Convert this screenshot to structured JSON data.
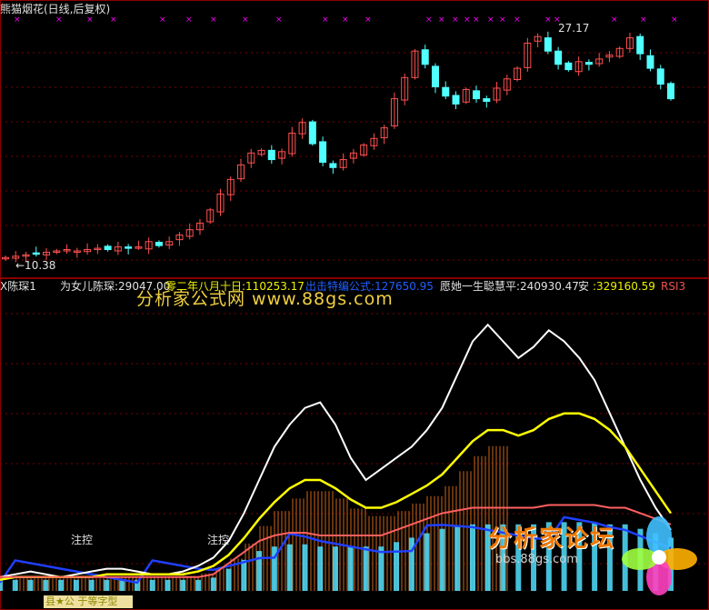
{
  "title": "熊猫烟花(日线,后复权)",
  "price_high_label": "27.17",
  "price_low_label": "←10.38",
  "indicator": {
    "name": "X陈琛1",
    "items": [
      {
        "label": "为女儿陈琛:29047.00",
        "color": "#e0e0e0"
      },
      {
        "label": "零二年八月十日:110253.17",
        "color": "#f0f000"
      },
      {
        "label": "出击",
        "color": "#2060ff"
      },
      {
        "label": "特编公式:127650.95",
        "color": "#2060ff"
      },
      {
        "label": "愿她一生聪慧平:240930.47",
        "color": "#e0e0e0"
      },
      {
        "label": "安",
        "color": "#e0e0e0"
      },
      {
        "label": ":329160.59",
        "color": "#f0f000"
      },
      {
        "label": "RSI3",
        "color": "#f05050"
      }
    ]
  },
  "annotations": [
    "注控",
    "注控"
  ],
  "watermarks": {
    "top": "分析家公式网 www.88gs.com",
    "logo": "分析家论坛",
    "url": "bbs.88gs.com"
  },
  "bottom_tab": "县★公 于等字型",
  "colors": {
    "up": "#ff5050",
    "down": "#50ffff",
    "marker": "#ff00ff",
    "white_line": "#ffffff",
    "yellow_line": "#ffff00",
    "red_line": "#ff6060",
    "blue_line": "#2040ff"
  },
  "chart_data": [
    {
      "type": "candlestick",
      "title": "熊猫烟花(日线,后复权)",
      "labels": [
        "27.17",
        "10.38"
      ],
      "closes": [
        10.4,
        10.5,
        10.6,
        10.7,
        10.8,
        10.9,
        11.0,
        10.9,
        11.0,
        11.1,
        11.0,
        11.2,
        11.1,
        11.2,
        11.6,
        11.3,
        11.6,
        12.1,
        12.5,
        13.0,
        14.0,
        15.2,
        16.3,
        17.4,
        18.3,
        18.5,
        17.8,
        18.4,
        19.8,
        20.6,
        19.0,
        17.6,
        17.2,
        17.8,
        18.3,
        18.9,
        19.4,
        20.2,
        22.4,
        24.0,
        26.0,
        25.0,
        23.3,
        22.6,
        22.0,
        23.1,
        22.4,
        22.2,
        23.2,
        23.9,
        24.7,
        26.6,
        27.1,
        26.0,
        25.0,
        24.6,
        25.2,
        25.0,
        25.4,
        25.7,
        26.2,
        27.0,
        25.8,
        24.7,
        23.5,
        22.4
      ]
    },
    {
      "type": "line",
      "title": "X陈琛1",
      "series": [
        {
          "name": "为女儿陈琛",
          "values": [
            5,
            6,
            7,
            6,
            5,
            6,
            7,
            8,
            8,
            7,
            6,
            6,
            7,
            9,
            12,
            18,
            28,
            40,
            52,
            60,
            66,
            68,
            60,
            48,
            40,
            44,
            48,
            52,
            58,
            66,
            78,
            90,
            96,
            90,
            84,
            88,
            94,
            90,
            84,
            76,
            64,
            52,
            40,
            30,
            22
          ]
        },
        {
          "name": "零二年八月十日",
          "values": [
            4,
            5,
            5,
            5,
            5,
            5,
            5,
            6,
            6,
            6,
            6,
            6,
            6,
            7,
            9,
            13,
            19,
            26,
            32,
            37,
            40,
            40,
            37,
            33,
            30,
            30,
            32,
            35,
            38,
            42,
            48,
            54,
            58,
            58,
            56,
            58,
            62,
            64,
            64,
            62,
            58,
            52,
            44,
            36,
            28
          ]
        },
        {
          "name": "RSI3",
          "values": [
            5,
            5,
            5,
            5,
            5,
            5,
            5,
            5,
            5,
            5,
            5,
            5,
            5,
            5,
            6,
            10,
            14,
            18,
            20,
            21,
            21,
            20,
            20,
            20,
            20,
            20,
            22,
            24,
            26,
            28,
            29,
            30,
            30,
            30,
            30,
            30,
            31,
            31,
            31,
            31,
            30,
            30,
            28,
            26,
            24
          ]
        }
      ]
    }
  ]
}
